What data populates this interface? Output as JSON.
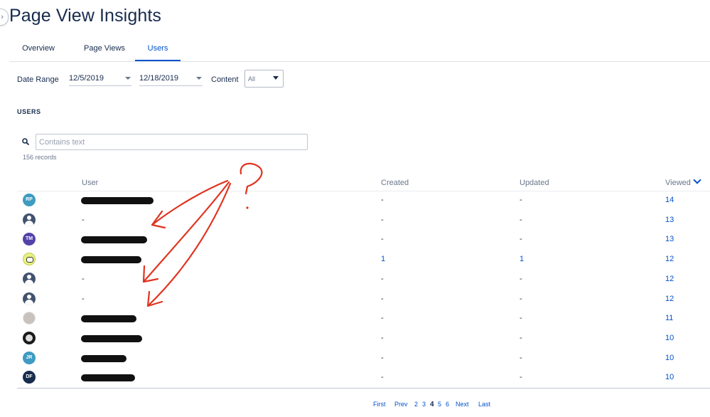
{
  "page": {
    "title": "Page View Insights"
  },
  "tabs": [
    {
      "label": "Overview"
    },
    {
      "label": "Page Views"
    },
    {
      "label": "Users"
    }
  ],
  "active_tab": "Users",
  "filters": {
    "date_range_label": "Date Range",
    "start_date": "12/5/2019",
    "end_date": "12/18/2019",
    "content_label": "Content",
    "content_value": "All"
  },
  "section": {
    "heading": "USERS",
    "search_placeholder": "Contains text",
    "records": "156 records"
  },
  "table": {
    "columns": {
      "user": "User",
      "created": "Created",
      "updated": "Updated",
      "viewed": "Viewed"
    },
    "rows": [
      {
        "avatar": "RP",
        "avatar_color": "#3e9bc2",
        "name": "",
        "redacted": true,
        "created": "-",
        "updated": "-",
        "viewed": "14"
      },
      {
        "avatar": "default-user-icon",
        "name": "-",
        "redacted": false,
        "created": "-",
        "updated": "-",
        "viewed": "13"
      },
      {
        "avatar": "TM",
        "avatar_color": "#5243aa",
        "name": "",
        "redacted": true,
        "created": "-",
        "updated": "-",
        "viewed": "13"
      },
      {
        "avatar": "panda-icon",
        "name": "",
        "redacted": true,
        "created": "1",
        "updated": "1",
        "viewed": "12"
      },
      {
        "avatar": "default-user-icon",
        "name": "-",
        "redacted": false,
        "created": "-",
        "updated": "-",
        "viewed": "12"
      },
      {
        "avatar": "default-user-icon",
        "name": "-",
        "redacted": false,
        "created": "-",
        "updated": "-",
        "viewed": "12"
      },
      {
        "avatar": "photo",
        "name": "",
        "redacted": true,
        "created": "-",
        "updated": "-",
        "viewed": "11"
      },
      {
        "avatar": "photo-dark",
        "name": "",
        "redacted": true,
        "created": "-",
        "updated": "-",
        "viewed": "10"
      },
      {
        "avatar": "JR",
        "avatar_color": "#3e9bc2",
        "name": "",
        "redacted": true,
        "created": "-",
        "updated": "-",
        "viewed": "10"
      },
      {
        "avatar": "DF",
        "avatar_color": "#172b4d",
        "name": "",
        "redacted": true,
        "created": "-",
        "updated": "-",
        "viewed": "10"
      }
    ]
  },
  "pagination": {
    "first": "First",
    "prev": "Prev",
    "pages": [
      "2",
      "3",
      "4",
      "5",
      "6"
    ],
    "current": "4",
    "next": "Next",
    "last": "Last"
  },
  "annotation": {
    "text": "?",
    "color": "#e0341f"
  }
}
